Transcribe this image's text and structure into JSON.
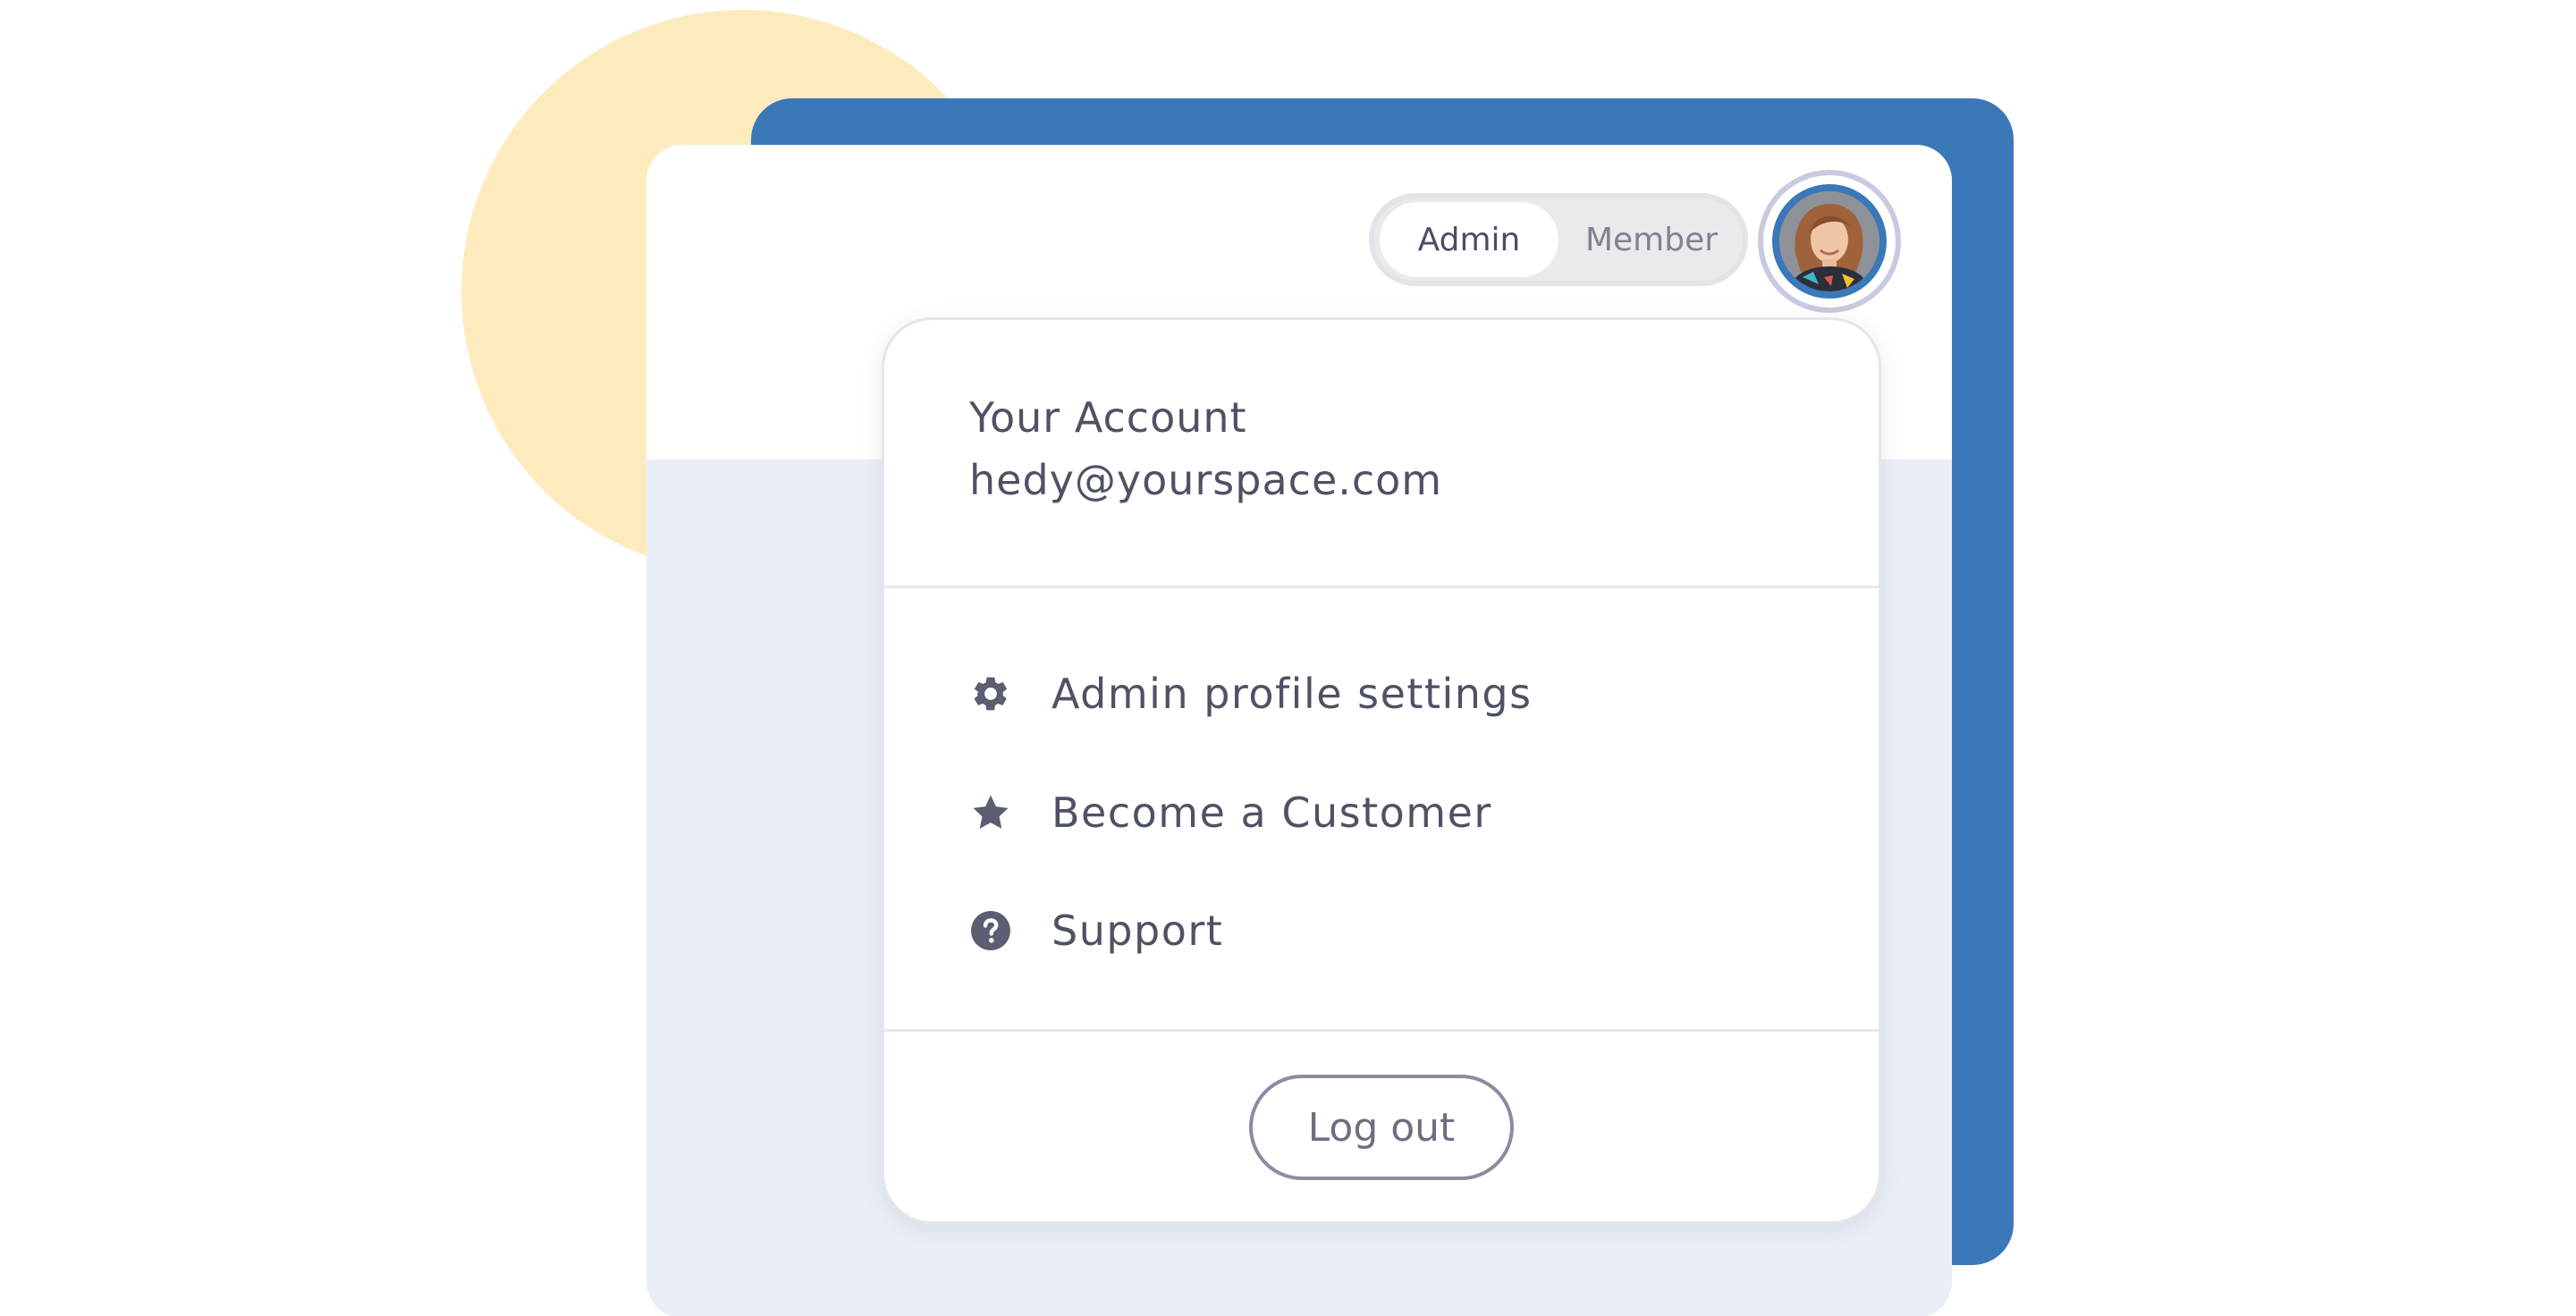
{
  "role_toggle": {
    "options": [
      "Admin",
      "Member"
    ],
    "selected": "Admin"
  },
  "account": {
    "title": "Your Account",
    "email": "hedy@yourspace.com"
  },
  "menu": {
    "items": [
      {
        "label": "Admin profile settings",
        "icon": "gear-icon"
      },
      {
        "label": "Become a Customer",
        "icon": "star-icon"
      },
      {
        "label": "Support",
        "icon": "question-circle-icon"
      }
    ]
  },
  "logout": {
    "label": "Log out"
  },
  "colors": {
    "accent_blue": "#3a78b8",
    "deco_yellow": "#feebbd",
    "panel_bg": "#eaeff7",
    "text": "#4f5264",
    "icon": "#5b5e70"
  }
}
